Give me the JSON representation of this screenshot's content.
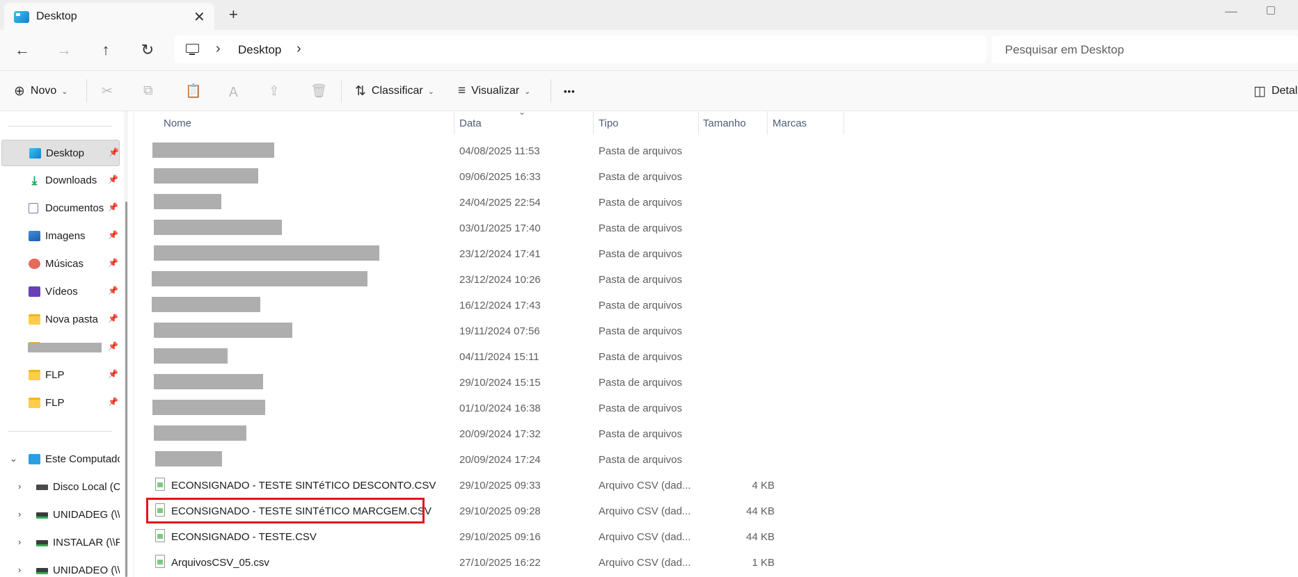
{
  "window": {
    "tab_title": "Desktop",
    "tab_close": "✕",
    "new_tab": "+",
    "minimize": "—"
  },
  "address": {
    "crumb_sep": "›",
    "location": "Desktop",
    "search_placeholder": "Pesquisar em Desktop"
  },
  "nav": {
    "back": "←",
    "forward": "→",
    "up": "↑",
    "refresh": "↻"
  },
  "toolbar": {
    "new_label": "Novo",
    "sort_label": "Classificar",
    "view_label": "Visualizar",
    "more_label": "•••",
    "details_label": "Detal",
    "icons": {
      "new": "⊕",
      "cut": "✂",
      "copy": "⧉",
      "paste": "📋",
      "rename": "Ａ",
      "share": "⇪",
      "delete": "🗑",
      "sort": "⇅",
      "view": "≡",
      "details": "◫"
    }
  },
  "sidebar": {
    "quick_access": [
      {
        "label": "Desktop",
        "icon": "desktop-icon",
        "pinned": true,
        "active": true
      },
      {
        "label": "Downloads",
        "icon": "download-icon",
        "pinned": true
      },
      {
        "label": "Documentos",
        "icon": "document-icon",
        "pinned": true
      },
      {
        "label": "Imagens",
        "icon": "image-icon",
        "pinned": true
      },
      {
        "label": "Músicas",
        "icon": "music-icon",
        "pinned": true
      },
      {
        "label": "Vídeos",
        "icon": "video-icon",
        "pinned": true
      },
      {
        "label": "Nova pasta",
        "icon": "folder-icon",
        "pinned": true
      },
      {
        "label": "",
        "icon": "folder-icon",
        "pinned": true,
        "redacted": true
      },
      {
        "label": "FLP",
        "icon": "folder-icon",
        "pinned": true
      },
      {
        "label": "FLP",
        "icon": "folder-icon",
        "pinned": true
      }
    ],
    "this_pc": {
      "label": "Este Computador",
      "drives": [
        {
          "label": "Disco Local (C:",
          "icon": "local-disk-icon"
        },
        {
          "label": "UNIDADEG (\\\\",
          "icon": "network-drive-icon"
        },
        {
          "label": "INSTALAR (\\\\P",
          "icon": "network-drive-icon"
        },
        {
          "label": "UNIDADEO (\\\\",
          "icon": "network-drive-icon"
        }
      ]
    }
  },
  "columns": {
    "name": "Nome",
    "date": "Data",
    "type": "Tipo",
    "size": "Tamanho",
    "tags": "Marcas"
  },
  "files": [
    {
      "name": "",
      "date": "04/08/2025 11:53",
      "type": "Pasta de arquivos",
      "size": "",
      "redacted": true
    },
    {
      "name": "",
      "date": "09/06/2025 16:33",
      "type": "Pasta de arquivos",
      "size": "",
      "redacted": true
    },
    {
      "name": "",
      "date": "24/04/2025 22:54",
      "type": "Pasta de arquivos",
      "size": "",
      "redacted": true
    },
    {
      "name": "",
      "date": "03/01/2025 17:40",
      "type": "Pasta de arquivos",
      "size": "",
      "redacted": true
    },
    {
      "name": "",
      "date": "23/12/2024 17:41",
      "type": "Pasta de arquivos",
      "size": "",
      "redacted": true
    },
    {
      "name": "",
      "date": "23/12/2024 10:26",
      "type": "Pasta de arquivos",
      "size": "",
      "redacted": true
    },
    {
      "name": "",
      "date": "16/12/2024 17:43",
      "type": "Pasta de arquivos",
      "size": "",
      "redacted": true
    },
    {
      "name": "",
      "date": "19/11/2024 07:56",
      "type": "Pasta de arquivos",
      "size": "",
      "redacted": true
    },
    {
      "name": "",
      "date": "04/11/2024 15:11",
      "type": "Pasta de arquivos",
      "size": "",
      "redacted": true
    },
    {
      "name": "",
      "date": "29/10/2024 15:15",
      "type": "Pasta de arquivos",
      "size": "",
      "redacted": true
    },
    {
      "name": "",
      "date": "01/10/2024 16:38",
      "type": "Pasta de arquivos",
      "size": "",
      "redacted": true
    },
    {
      "name": "",
      "date": "20/09/2024 17:32",
      "type": "Pasta de arquivos",
      "size": "",
      "redacted": true
    },
    {
      "name": "",
      "date": "20/09/2024 17:24",
      "type": "Pasta de arquivos",
      "size": "",
      "redacted": true
    },
    {
      "name": "ECONSIGNADO - TESTE SINTéTICO DESCONTO.CSV",
      "date": "29/10/2025 09:33",
      "type": "Arquivo CSV (dad...",
      "size": "4 KB"
    },
    {
      "name": "ECONSIGNADO - TESTE SINTéTICO MARCGEM.CSV",
      "date": "29/10/2025 09:28",
      "type": "Arquivo CSV (dad...",
      "size": "44 KB",
      "highlighted": true
    },
    {
      "name": "ECONSIGNADO - TESTE.CSV",
      "date": "29/10/2025 09:16",
      "type": "Arquivo CSV (dad...",
      "size": "44 KB"
    },
    {
      "name": "ArquivosCSV_05.csv",
      "date": "27/10/2025 16:22",
      "type": "Arquivo CSV (dad...",
      "size": "1 KB"
    }
  ],
  "colors": {
    "highlight": "#e0151b",
    "redaction": "#aeaeae"
  }
}
